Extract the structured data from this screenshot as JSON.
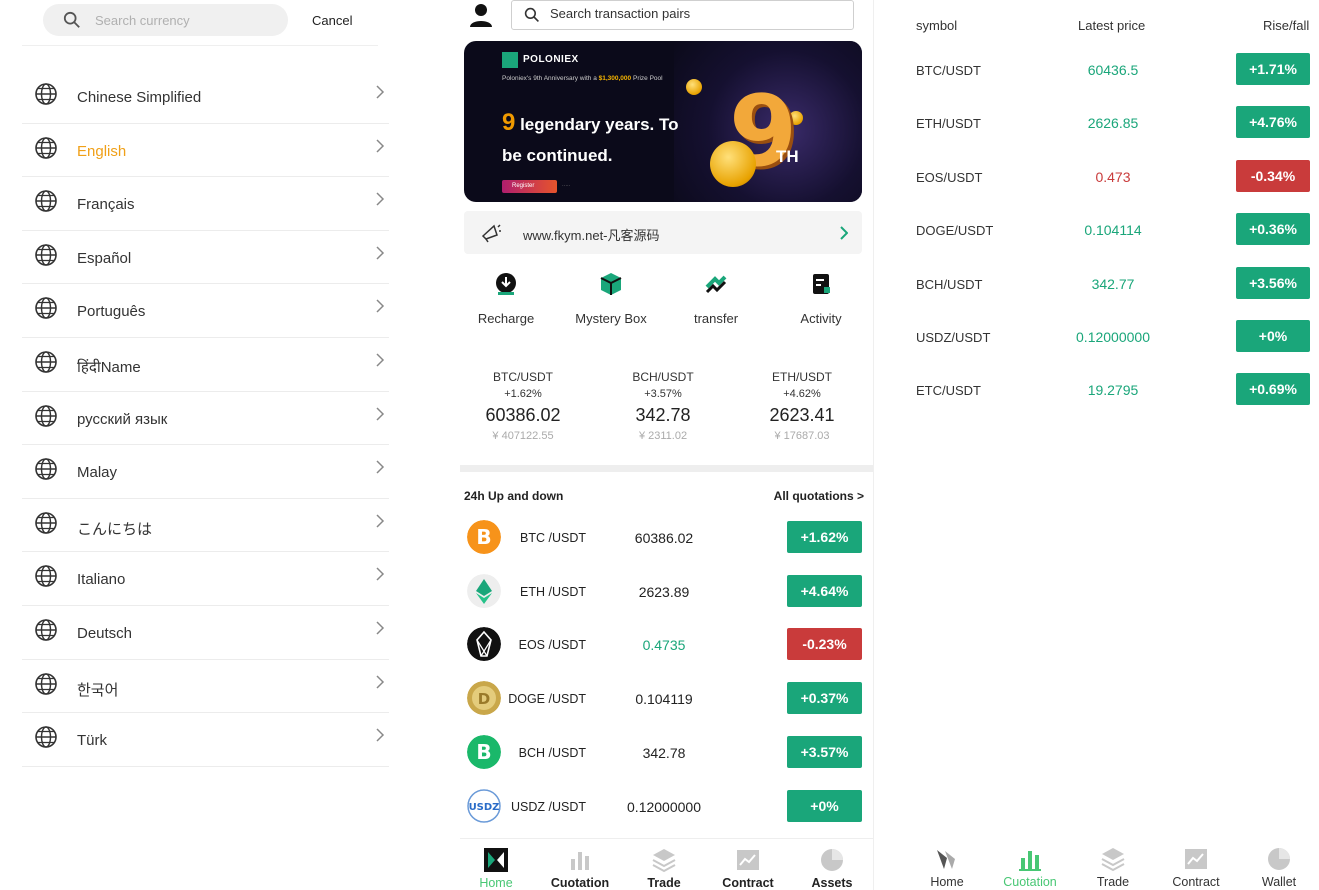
{
  "left_panel": {
    "search": {
      "placeholder": "Search currency"
    },
    "cancel_label": "Cancel",
    "languages": [
      {
        "label": "Chinese Simplified",
        "active": false
      },
      {
        "label": "English",
        "active": true
      },
      {
        "label": "Français",
        "active": false
      },
      {
        "label": "Español",
        "active": false
      },
      {
        "label": "Português",
        "active": false
      },
      {
        "label": "हिंदीName",
        "active": false
      },
      {
        "label": "русский язык",
        "active": false
      },
      {
        "label": "Malay",
        "active": false
      },
      {
        "label": "こんにちは",
        "active": false
      },
      {
        "label": "Italiano",
        "active": false
      },
      {
        "label": "Deutsch",
        "active": false
      },
      {
        "label": "한국어",
        "active": false
      },
      {
        "label": "Türk",
        "active": false
      }
    ]
  },
  "middle_panel": {
    "search": {
      "placeholder": "Search transaction pairs"
    },
    "banner": {
      "brand": "POLONIEX",
      "sub_prefix": "Poloniex's 9th Anniversary with a ",
      "sub_amount": "$1,300,000",
      "sub_suffix": " Prize Pool",
      "head_num": "9",
      "head_text": " legendary years. To be continued.",
      "register_label": "Register",
      "big_nine": "9",
      "th": "TH"
    },
    "notice": {
      "text": "www.fkym.net-凡客源码"
    },
    "quick_actions": [
      {
        "label": "Recharge",
        "icon": "recharge-icon"
      },
      {
        "label": "Mystery Box",
        "icon": "mystery-box-icon"
      },
      {
        "label": "transfer",
        "icon": "transfer-icon"
      },
      {
        "label": "Activity",
        "icon": "activity-icon"
      }
    ],
    "tickers": [
      {
        "pair": "BTC/USDT",
        "change": "+1.62%",
        "price": "60386.02",
        "cny": "¥ 407122.55"
      },
      {
        "pair": "BCH/USDT",
        "change": "+3.57%",
        "price": "342.78",
        "cny": "¥ 2311.02"
      },
      {
        "pair": "ETH/USDT",
        "change": "+4.62%",
        "price": "2623.41",
        "cny": "¥ 17687.03"
      }
    ],
    "updown": {
      "title": "24h Up and down",
      "all_label": "All quotations >",
      "rows": [
        {
          "pair": "BTC /USDT",
          "price": "60386.02",
          "price_green": false,
          "change": "+1.62%",
          "direction": "up",
          "coin": "btc"
        },
        {
          "pair": "ETH /USDT",
          "price": "2623.89",
          "price_green": false,
          "change": "+4.64%",
          "direction": "up",
          "coin": "eth"
        },
        {
          "pair": "EOS /USDT",
          "price": "0.4735",
          "price_green": true,
          "change": "-0.23%",
          "direction": "down",
          "coin": "eos"
        },
        {
          "pair": "DOGE /USDT",
          "price": "0.104119",
          "price_green": false,
          "change": "+0.37%",
          "direction": "up",
          "coin": "doge"
        },
        {
          "pair": "BCH /USDT",
          "price": "342.78",
          "price_green": false,
          "change": "+3.57%",
          "direction": "up",
          "coin": "bch"
        },
        {
          "pair": "USDZ /USDT",
          "price": "0.12000000",
          "price_green": false,
          "change": "+0%",
          "direction": "up",
          "coin": "usdz"
        }
      ]
    },
    "nav": [
      {
        "label": "Home",
        "active": true
      },
      {
        "label": "Cuotation",
        "active": false
      },
      {
        "label": "Trade",
        "active": false
      },
      {
        "label": "Contract",
        "active": false
      },
      {
        "label": "Assets",
        "active": false
      }
    ]
  },
  "right_panel": {
    "headers": {
      "symbol": "symbol",
      "price": "Latest price",
      "change": "Rise/fall"
    },
    "rows": [
      {
        "symbol": "BTC/USDT",
        "price": "60436.5",
        "change": "+1.71%",
        "direction": "up"
      },
      {
        "symbol": "ETH/USDT",
        "price": "2626.85",
        "change": "+4.76%",
        "direction": "up"
      },
      {
        "symbol": "EOS/USDT",
        "price": "0.473",
        "change": "-0.34%",
        "direction": "down"
      },
      {
        "symbol": "DOGE/USDT",
        "price": "0.104114",
        "change": "+0.36%",
        "direction": "up"
      },
      {
        "symbol": "BCH/USDT",
        "price": "342.77",
        "change": "+3.56%",
        "direction": "up"
      },
      {
        "symbol": "USDZ/USDT",
        "price": "0.12000000",
        "change": "+0%",
        "direction": "up"
      },
      {
        "symbol": "ETC/USDT",
        "price": "19.2795",
        "change": "+0.69%",
        "direction": "up"
      }
    ],
    "nav": [
      {
        "label": "Home",
        "active": false
      },
      {
        "label": "Cuotation",
        "active": true
      },
      {
        "label": "Trade",
        "active": false
      },
      {
        "label": "Contract",
        "active": false
      },
      {
        "label": "Wallet",
        "active": false
      }
    ]
  },
  "colors": {
    "up": "#1aa67a",
    "down": "#c93b3b",
    "active_lang": "#f0a018",
    "nav_active": "#48c774"
  }
}
